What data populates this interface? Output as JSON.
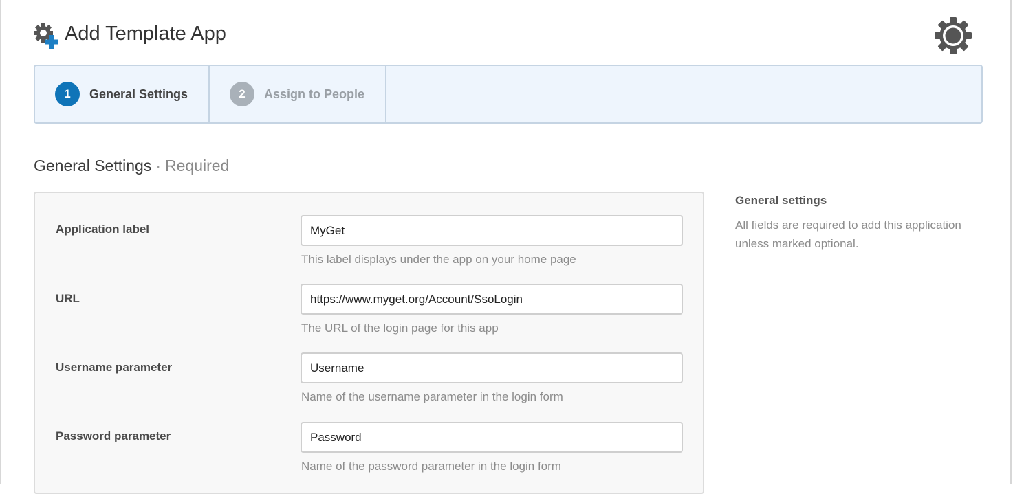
{
  "header": {
    "title": "Add Template App",
    "title_icon": "gear-plus-icon",
    "settings_icon": "gear-icon"
  },
  "wizard": {
    "steps": [
      {
        "number": "1",
        "label": "General Settings",
        "active": true
      },
      {
        "number": "2",
        "label": "Assign to People",
        "active": false
      }
    ]
  },
  "section": {
    "title": "General Settings",
    "separator": "·",
    "qualifier": "Required"
  },
  "form": {
    "fields": [
      {
        "label": "Application label",
        "value": "MyGet",
        "help": "This label displays under the app on your home page"
      },
      {
        "label": "URL",
        "value": "https://www.myget.org/Account/SsoLogin",
        "help": "The URL of the login page for this app"
      },
      {
        "label": "Username parameter",
        "value": "Username",
        "help": "Name of the username parameter in the login form"
      },
      {
        "label": "Password parameter",
        "value": "Password",
        "help": "Name of the password parameter in the login form"
      }
    ]
  },
  "side_help": {
    "title": "General settings",
    "text": "All fields are required to add this application unless marked optional."
  },
  "colors": {
    "accent": "#0f74b8",
    "plus": "#1d7fc4",
    "inactive_step": "#a9b1b9",
    "steps_bg": "#eef5fd"
  }
}
